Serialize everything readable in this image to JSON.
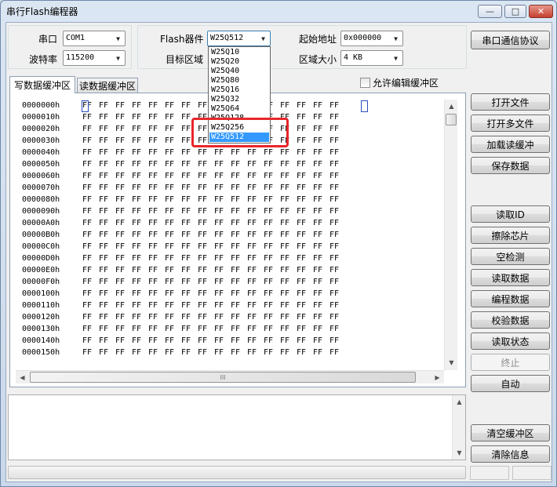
{
  "window": {
    "title": "串行Flash编程器",
    "controls": {
      "minimize": "—",
      "maximize": "□",
      "close": "✕"
    }
  },
  "serial": {
    "port_label": "串口",
    "port_value": "COM1",
    "baud_label": "波特率",
    "baud_value": "115200"
  },
  "flash": {
    "device_label": "Flash器件",
    "device_value": "W25Q512",
    "target_label": "目标区域",
    "options": [
      "W25Q10",
      "W25Q20",
      "W25Q40",
      "W25Q80",
      "W25Q16",
      "W25Q32",
      "W25Q64",
      "W25Q128",
      "W25Q256",
      "W25Q512"
    ],
    "selected_option": "W25Q512"
  },
  "address": {
    "start_label": "起始地址",
    "start_value": "0x000000",
    "size_label": "区域大小",
    "size_value": "4 KB"
  },
  "buttons": {
    "protocol": "串口通信协议",
    "open_file": "打开文件",
    "open_multi": "打开多文件",
    "load_read_buffer": "加载读缓冲",
    "save_data": "保存数据",
    "read_id": "读取ID",
    "erase_chip": "擦除芯片",
    "blank_check": "空检测",
    "read_data": "读取数据",
    "program_data": "编程数据",
    "verify_data": "校验数据",
    "read_status": "读取状态",
    "stop": "终止",
    "auto": "自动",
    "clear_buffer": "清空缓冲区",
    "clear_info": "清除信息"
  },
  "tabs": {
    "write_buffer": "写数据缓冲区",
    "read_buffer": "读数据缓冲区"
  },
  "allow_edit": {
    "label": "允许编辑缓冲区",
    "checked": false
  },
  "hex": {
    "fill_byte": "FF",
    "bytes_per_row": 16,
    "addresses": [
      "0000000h",
      "0000010h",
      "0000020h",
      "0000030h",
      "0000040h",
      "0000050h",
      "0000060h",
      "0000070h",
      "0000080h",
      "0000090h",
      "00000A0h",
      "00000B0h",
      "00000C0h",
      "00000D0h",
      "00000E0h",
      "00000F0h",
      "0000100h",
      "0000110h",
      "0000120h",
      "0000130h",
      "0000140h",
      "0000150h"
    ]
  },
  "scroll_glyphs": {
    "up": "▲",
    "down": "▼",
    "left": "◀",
    "right": "▶",
    "grip": "III"
  },
  "combo_arrow": "▼"
}
